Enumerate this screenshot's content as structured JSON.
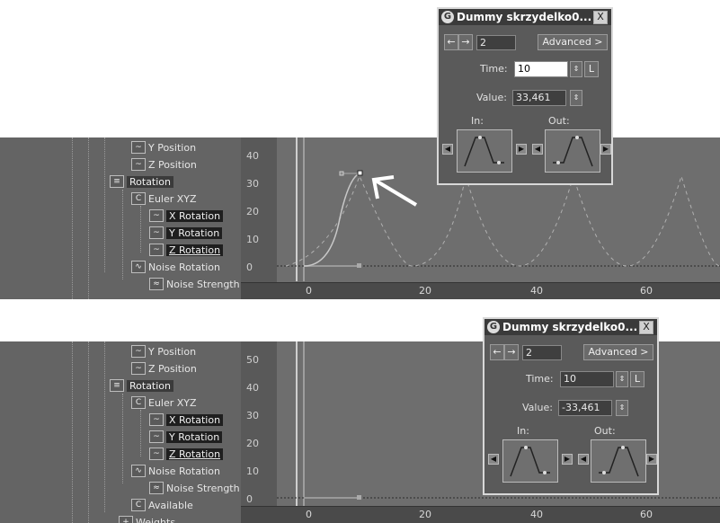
{
  "panels": [
    {
      "tree": [
        {
          "label": "Y Position",
          "icon": "curve-icon",
          "sel": "none",
          "ul": false
        },
        {
          "label": "Z Position",
          "icon": "curve-icon",
          "sel": "none",
          "ul": false
        },
        {
          "label": "Rotation",
          "icon": "list-icon",
          "sel": "sel2",
          "ul": false
        },
        {
          "label": "Euler XYZ",
          "icon": "controller-icon",
          "sel": "none",
          "ul": false
        },
        {
          "label": "X Rotation",
          "icon": "curve-icon",
          "sel": "sel",
          "ul": false
        },
        {
          "label": "Y Rotation",
          "icon": "curve-icon",
          "sel": "sel",
          "ul": false
        },
        {
          "label": "Z Rotation",
          "icon": "curve-icon",
          "sel": "sel",
          "ul": true
        },
        {
          "label": "Noise Rotation",
          "icon": "noise-icon",
          "sel": "none",
          "ul": false
        },
        {
          "label": "Noise Strength",
          "icon": "noise-strength-icon",
          "sel": "none",
          "ul": false
        }
      ],
      "ruler": [
        "40",
        "30",
        "20",
        "10",
        "0"
      ],
      "timeline": [
        "0",
        "20",
        "40",
        "60"
      ]
    },
    {
      "tree": [
        {
          "label": "Y Position",
          "icon": "curve-icon",
          "sel": "none",
          "ul": false
        },
        {
          "label": "Z Position",
          "icon": "curve-icon",
          "sel": "none",
          "ul": false
        },
        {
          "label": "Rotation",
          "icon": "list-icon",
          "sel": "sel2",
          "ul": false
        },
        {
          "label": "Euler XYZ",
          "icon": "controller-icon",
          "sel": "none",
          "ul": false
        },
        {
          "label": "X Rotation",
          "icon": "curve-icon",
          "sel": "sel",
          "ul": false
        },
        {
          "label": "Y Rotation",
          "icon": "curve-icon",
          "sel": "sel",
          "ul": false
        },
        {
          "label": "Z Rotation",
          "icon": "curve-icon",
          "sel": "sel",
          "ul": true
        },
        {
          "label": "Noise Rotation",
          "icon": "noise-icon",
          "sel": "none",
          "ul": false
        },
        {
          "label": "Noise Strength",
          "icon": "noise-strength-icon",
          "sel": "none",
          "ul": false
        },
        {
          "label": "Available",
          "icon": "controller-icon",
          "sel": "none",
          "ul": false
        },
        {
          "label": "Weights",
          "icon": "plus-icon",
          "sel": "none",
          "ul": false
        }
      ],
      "ruler": [
        "50",
        "40",
        "30",
        "20",
        "10",
        "0"
      ],
      "timeline": [
        "0",
        "20",
        "40",
        "60"
      ]
    }
  ],
  "dialogs": [
    {
      "title": "Dummy skrzydelko0...",
      "close": "X",
      "key": "2",
      "advanced": "Advanced >",
      "time_label": "Time:",
      "time": "10",
      "lock": "L",
      "value_label": "Value:",
      "value": "33,461",
      "in_label": "In:",
      "out_label": "Out:"
    },
    {
      "title": "Dummy skrzydelko0...",
      "close": "X",
      "key": "2",
      "advanced": "Advanced >",
      "time_label": "Time:",
      "time": "10",
      "lock": "L",
      "value_label": "Value:",
      "value": "-33,461",
      "in_label": "In:",
      "out_label": "Out:"
    }
  ]
}
